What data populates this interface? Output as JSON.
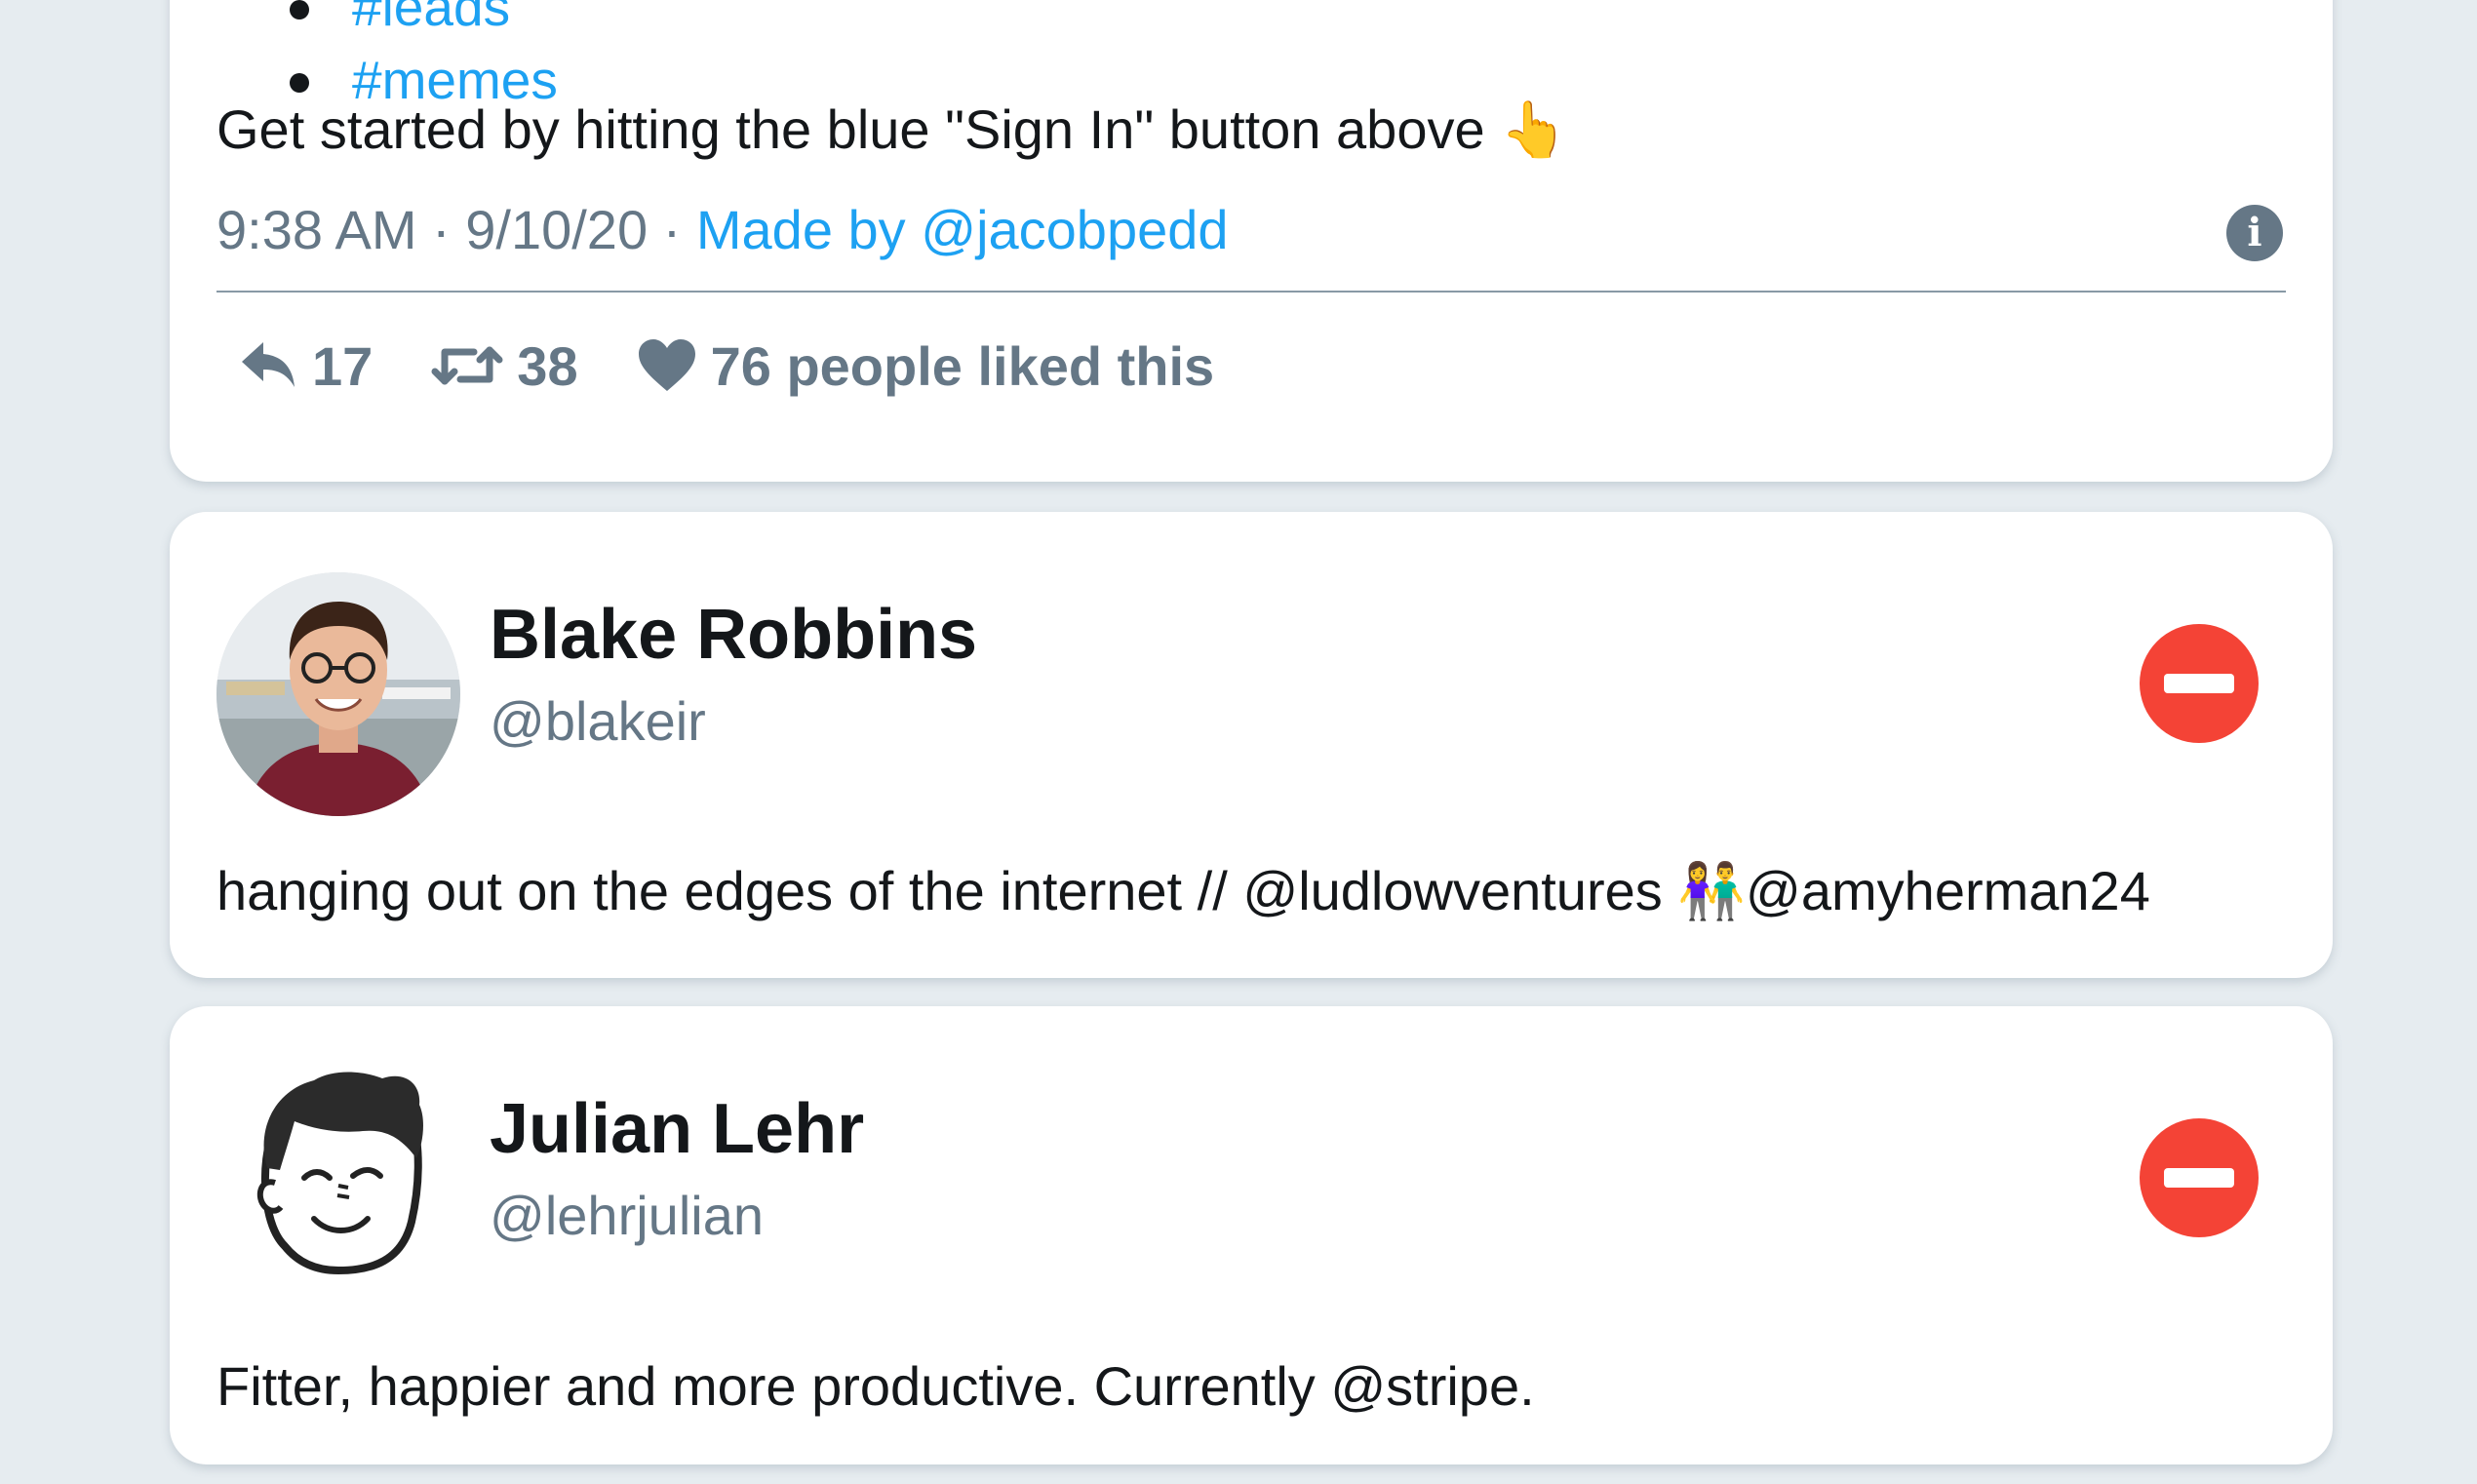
{
  "tweet": {
    "hashtags": [
      "#leads",
      "#memes"
    ],
    "text": "Get started by hitting the blue \"Sign In\" button above 👆",
    "time": "9:38 AM",
    "date": "9/10/20",
    "made_by": "Made by @jacobpedd",
    "info_icon": "info-icon",
    "reply_count": "17",
    "retweet_count": "38",
    "likes_text": "76 people liked this"
  },
  "users": [
    {
      "name": "Blake Robbins",
      "handle": "@blakeir",
      "bio": "hanging out on the edges of the internet // @ludlowventures 👫@amyherman24",
      "avatar": "photo-avatar",
      "remove_icon": "remove-icon"
    },
    {
      "name": "Julian Lehr",
      "handle": "@lehrjulian",
      "bio": "Fitter, happier and more productive. Currently @stripe.",
      "avatar": "cartoon-avatar",
      "remove_icon": "remove-icon"
    }
  ],
  "colors": {
    "background": "#e6ecf0",
    "link": "#1da1f2",
    "muted": "#657786",
    "remove": "#f44336"
  }
}
